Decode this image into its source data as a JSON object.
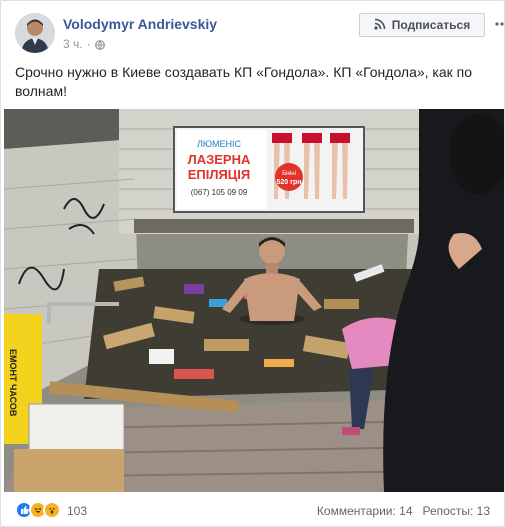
{
  "post": {
    "author": "Volodymyr Andrievskiy",
    "time": "3 ч.",
    "separator": "·",
    "subscribe_label": "Подписаться",
    "text": "Срочно нужно в Киеве создавать КП «Гондола». КП «Гондола», как по волнам!"
  },
  "photo": {
    "ad_brand": "ЛЮМЕНІС",
    "ad_line1": "ЛАЗЕРНА",
    "ad_line2": "ЕПІЛЯЦІЯ",
    "ad_phone": "(067) 105 09 09",
    "ad_price_label": "Бікіні",
    "ad_price": "520 грн",
    "sign_text": "ЕМОНТ ЧАСОВ"
  },
  "footer": {
    "reaction_count": "103",
    "comments": "Комментарии: 14",
    "shares": "Репосты: 13"
  },
  "colors": {
    "link_blue": "#385898",
    "like_blue": "#2078f4",
    "haha_yellow": "#f7b125",
    "ad_red": "#e2332a"
  },
  "icons": [
    "rss-icon",
    "globe-icon",
    "more-icon",
    "like-icon",
    "haha-icon",
    "wow-icon"
  ]
}
